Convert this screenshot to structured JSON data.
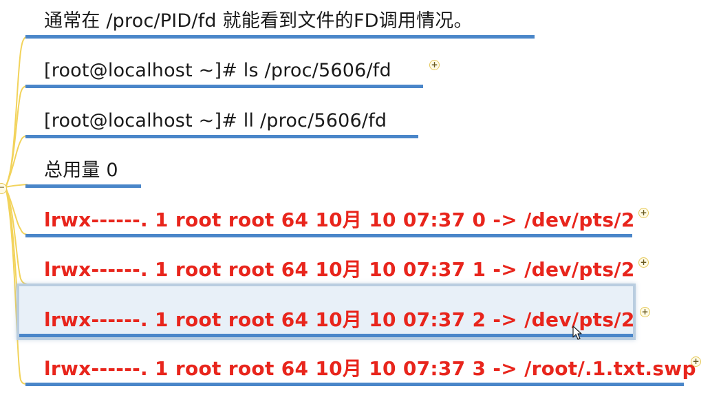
{
  "mindmap": {
    "nodes": [
      {
        "text": "通常在 /proc/PID/fd  就能看到文件的FD调用情况。",
        "style": "normal",
        "has_expand": false
      },
      {
        "text": "[root@localhost ~]# ls /proc/5606/fd",
        "style": "normal",
        "has_expand": true
      },
      {
        "text": "[root@localhost ~]# ll /proc/5606/fd",
        "style": "normal",
        "has_expand": false
      },
      {
        "text": "总用量 0",
        "style": "normal",
        "has_expand": false
      },
      {
        "text": "lrwx------. 1 root root 64 10月 10 07:37 0 -> /dev/pts/2",
        "style": "warn",
        "has_expand": true
      },
      {
        "text": "lrwx------. 1 root root 64 10月 10 07:37 1 -> /dev/pts/2",
        "style": "warn",
        "has_expand": true
      },
      {
        "text": "lrwx------. 1 root root 64 10月 10 07:37 2 -> /dev/pts/2",
        "style": "warn",
        "has_expand": true,
        "selected": true
      },
      {
        "text": "lrwx------. 1 root root 64 10月 10 07:37 3 -> /root/.1.txt.swp",
        "style": "warn",
        "has_expand": true
      }
    ],
    "expand_glyph": "+",
    "collapse_glyph": "−"
  },
  "colors": {
    "underline": "#4a86c9",
    "connector": "#f2d35b",
    "warn_text": "#e8251c",
    "normal_text": "#1a1a1a",
    "selection_bg": "#e8f0f8"
  }
}
